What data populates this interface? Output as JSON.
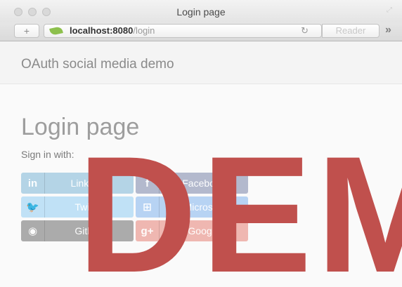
{
  "window": {
    "title": "Login page"
  },
  "toolbar": {
    "new_tab_label": "+",
    "url_host": "localhost:8080",
    "url_path": "/login",
    "reload_glyph": "↻",
    "reader_label": "Reader",
    "more_glyph": "»"
  },
  "navbar": {
    "brand": "OAuth social media demo"
  },
  "main": {
    "title": "Login page",
    "sign_in_text": "Sign in with:"
  },
  "providers": [
    {
      "icon": "linkedin-icon",
      "glyph": "in",
      "label": "LinkedIn",
      "color": "#b4d4e6"
    },
    {
      "icon": "facebook-icon",
      "glyph": "f",
      "label": "Facebook",
      "color": "#b3b9cd"
    },
    {
      "icon": "twitter-icon",
      "glyph": "🐦",
      "label": "Twitter",
      "color": "#c0e1f6"
    },
    {
      "icon": "microsoft-icon",
      "glyph": "⊞",
      "label": "Microsoft",
      "color": "#b7d3f3"
    },
    {
      "icon": "github-icon",
      "glyph": "◉",
      "label": "Github",
      "color": "#ababab"
    },
    {
      "icon": "google-plus-icon",
      "glyph": "g+",
      "label": "Google",
      "color": "#efb7b1"
    }
  ],
  "watermark": {
    "text": "DEMO",
    "color": "#c0504d"
  }
}
